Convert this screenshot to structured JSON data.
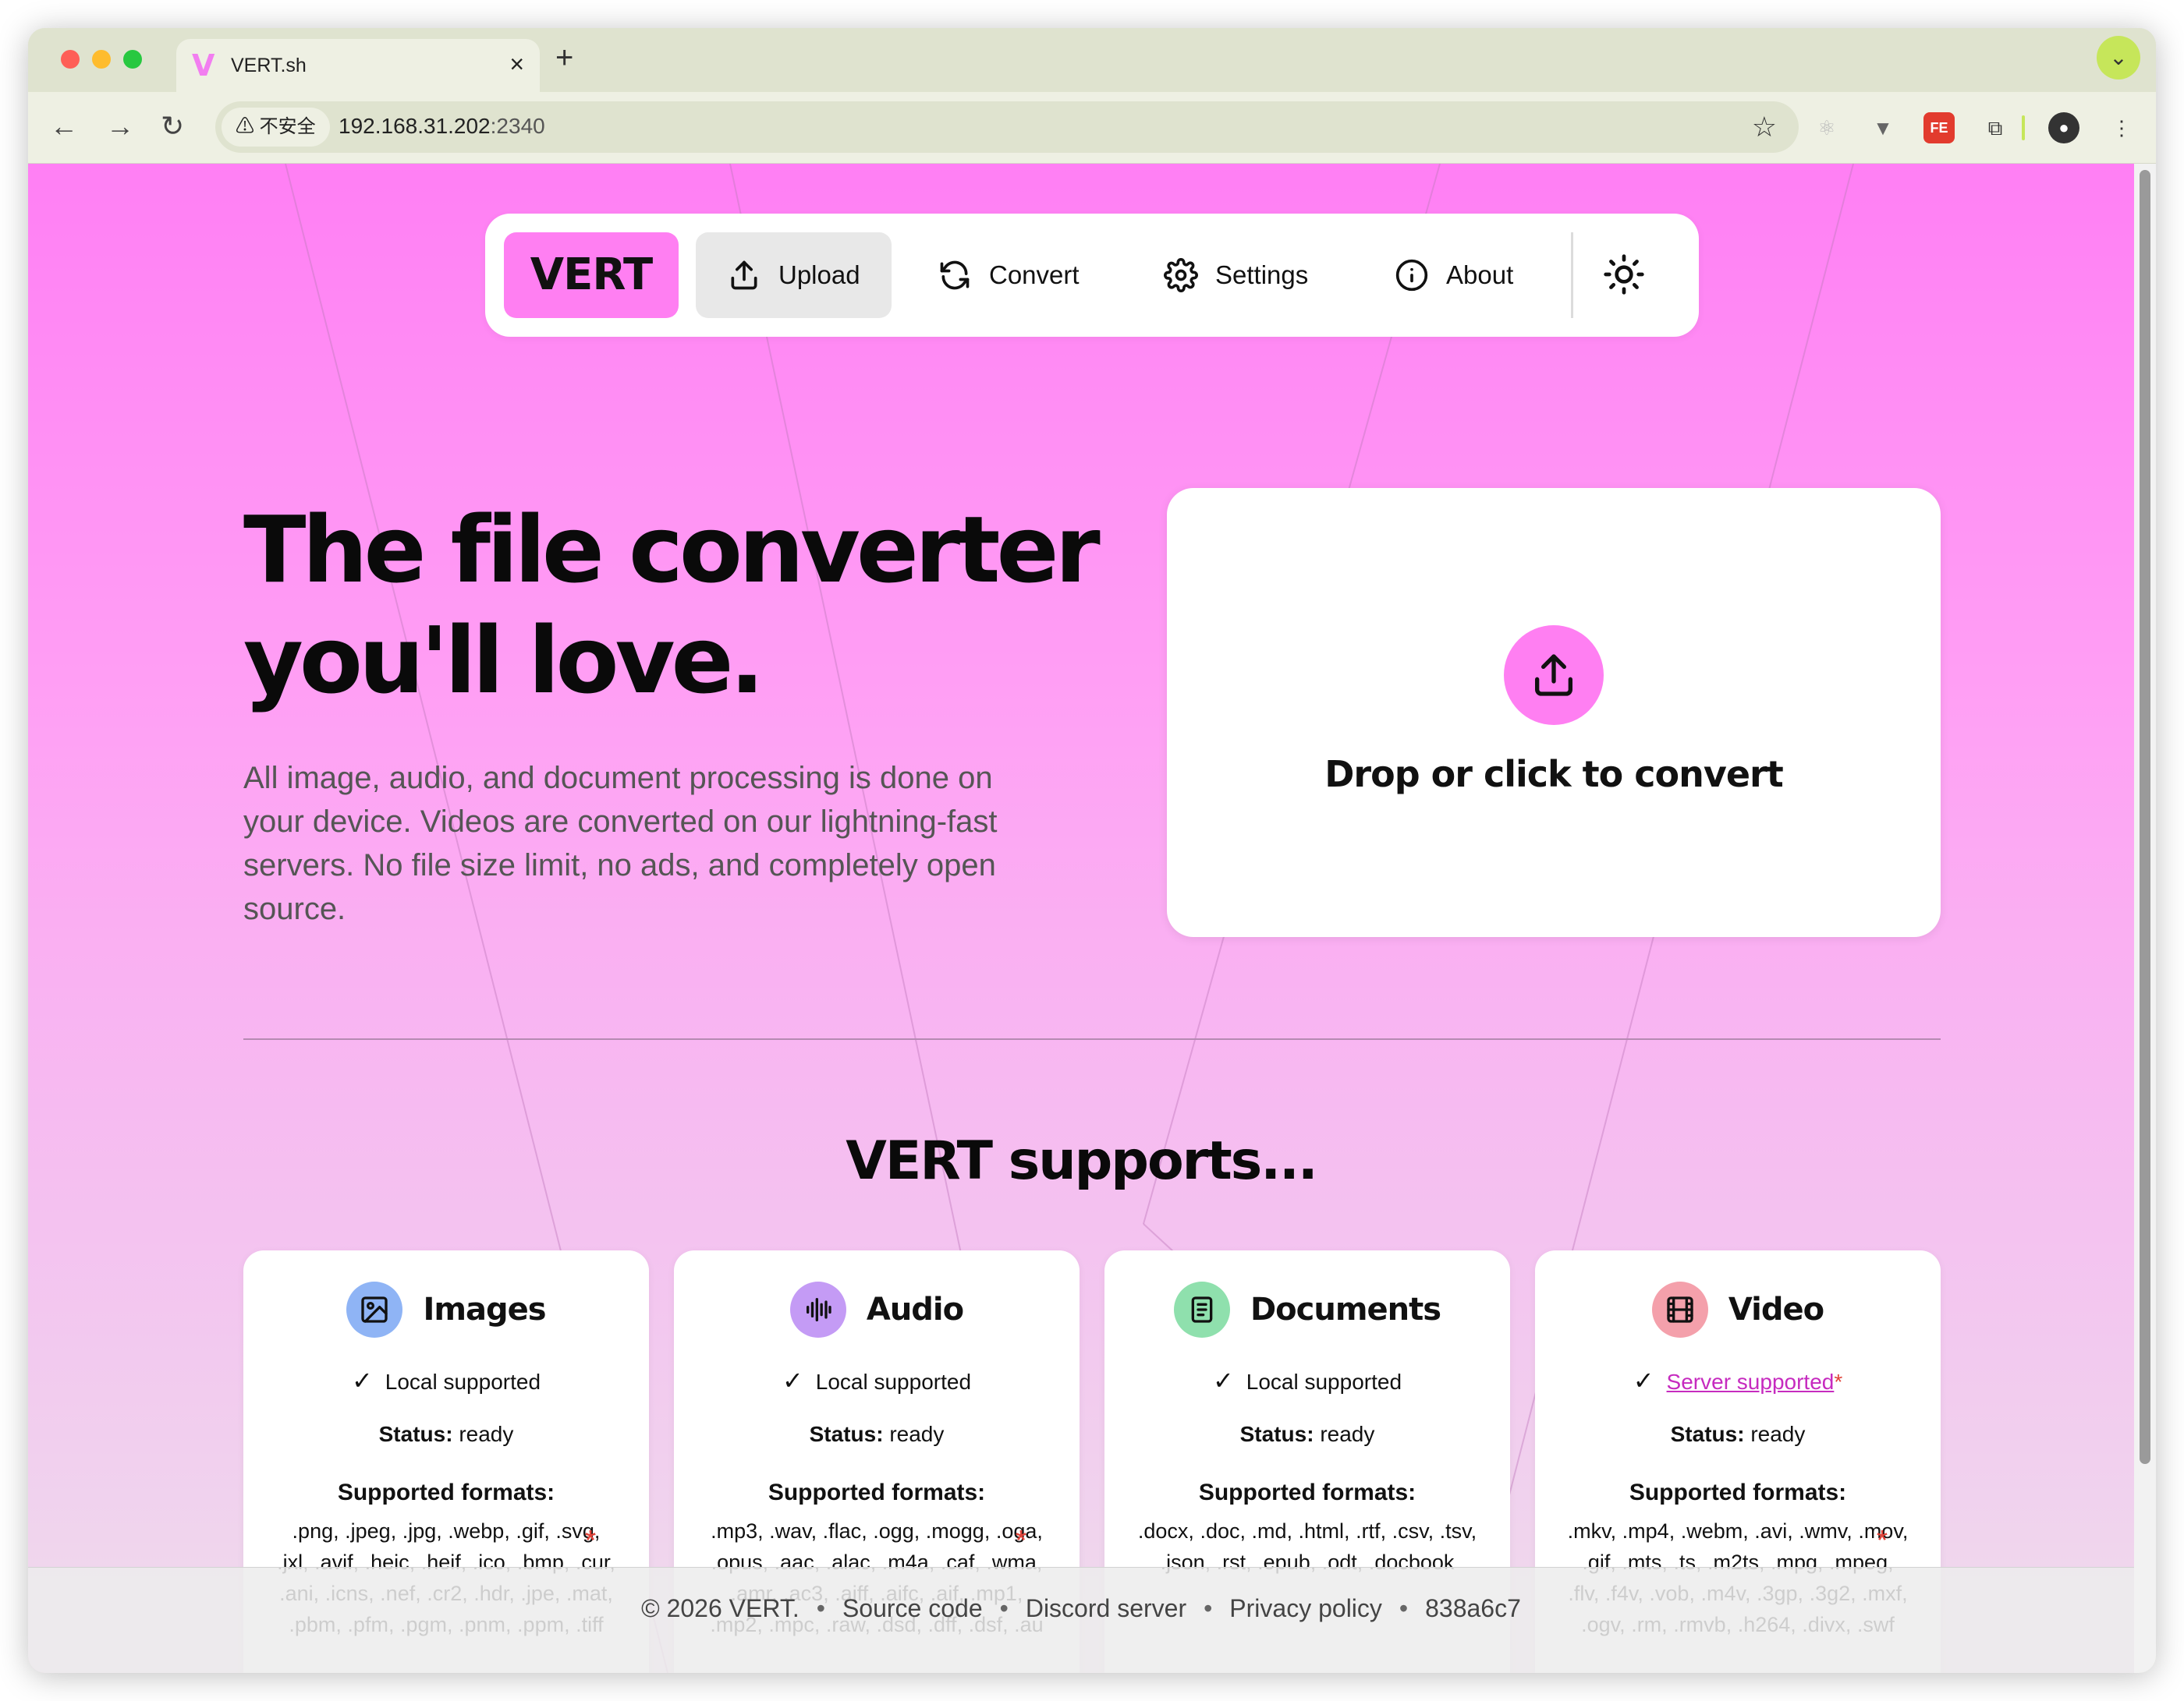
{
  "browser": {
    "tab_logo": "V",
    "tab_title": "VERT.sh",
    "tab_close": "×",
    "new_tab": "+",
    "security_label": "⚠ 不安全",
    "url_host": "192.168.31.202",
    "url_port": ":2340"
  },
  "nav": {
    "logo": "VERT",
    "items": [
      {
        "label": "Upload",
        "icon": "upload-icon",
        "active": true
      },
      {
        "label": "Convert",
        "icon": "refresh-icon",
        "active": false
      },
      {
        "label": "Settings",
        "icon": "gear-icon",
        "active": false
      },
      {
        "label": "About",
        "icon": "info-icon",
        "active": false
      }
    ],
    "theme_icon": "sun-icon"
  },
  "hero": {
    "title_line1": "The file converter",
    "title_line2": "you'll love.",
    "subtitle": "All image, audio, and document processing is done on your device. Videos are converted on our lightning-fast servers. No file size limit, no ads, and completely open source."
  },
  "dropzone": {
    "label": "Drop or click to convert",
    "icon": "upload-icon"
  },
  "supports": {
    "title": "VERT supports...",
    "status_label": "Status:",
    "formats_label": "Supported formats:",
    "cards": [
      {
        "name": "Images",
        "icon": "image-icon",
        "icon_bg": "#8fb4f5",
        "support": "Local supported",
        "status": "ready",
        "formats": [
          ".png",
          ".jpeg",
          ".jpg",
          ".webp",
          ".gif",
          ".svg",
          ".jxl",
          ".avif",
          ".heic*",
          ".heif*",
          ".ico",
          ".bmp",
          ".cur",
          ".ani*",
          ".icns*",
          ".nef*",
          ".cr2*",
          ".hdr",
          ".jpe",
          ".mat",
          ".pbm",
          ".pfm",
          ".pgm",
          ".pnm",
          ".ppm",
          ".tiff"
        ]
      },
      {
        "name": "Audio",
        "icon": "waveform-icon",
        "icon_bg": "#c49bf5",
        "support": "Local supported",
        "status": "ready",
        "formats": [
          ".mp3",
          ".wav",
          ".flac",
          ".ogg",
          ".mogg*",
          ".oga",
          ".opus",
          ".aac",
          ".alac",
          ".m4a",
          ".caf*",
          ".wma",
          ".amr",
          ".ac3",
          ".aiff",
          ".aifc",
          ".aif",
          ".mp1*",
          ".mp2",
          ".mpc*",
          ".raw",
          ".dsd*",
          ".dff*",
          ".dsf",
          ".au"
        ]
      },
      {
        "name": "Documents",
        "icon": "document-icon",
        "icon_bg": "#8fe0ad",
        "support": "Local supported",
        "status": "ready",
        "formats": [
          ".docx",
          ".doc",
          ".md",
          ".html",
          ".rtf",
          ".csv",
          ".tsv",
          ".json",
          ".rst",
          ".epub",
          ".odt",
          ".docbook"
        ]
      },
      {
        "name": "Video",
        "icon": "film-icon",
        "icon_bg": "#f4a0ab",
        "support": "Server supported",
        "support_link": true,
        "status": "ready",
        "formats": [
          ".mkv",
          ".mp4",
          ".webm",
          ".avi",
          ".wmv",
          ".mov",
          ".gif",
          ".mts",
          ".ts",
          ".m2ts",
          ".mpg",
          ".mpeg",
          ".flv",
          ".f4v",
          ".vob",
          ".m4v",
          ".3gp",
          ".3g2",
          ".mxf",
          ".ogv",
          ".rm*",
          ".rmvb*",
          ".h264",
          ".divx",
          ".swf"
        ]
      }
    ]
  },
  "footer": {
    "items": [
      "© 2026 VERT.",
      "Source code",
      "Discord server",
      "Privacy policy",
      "838a6c7"
    ]
  },
  "colors": {
    "accent": "#ff7ff2",
    "link": "#c62bbf",
    "asterisk": "#e0443a"
  }
}
